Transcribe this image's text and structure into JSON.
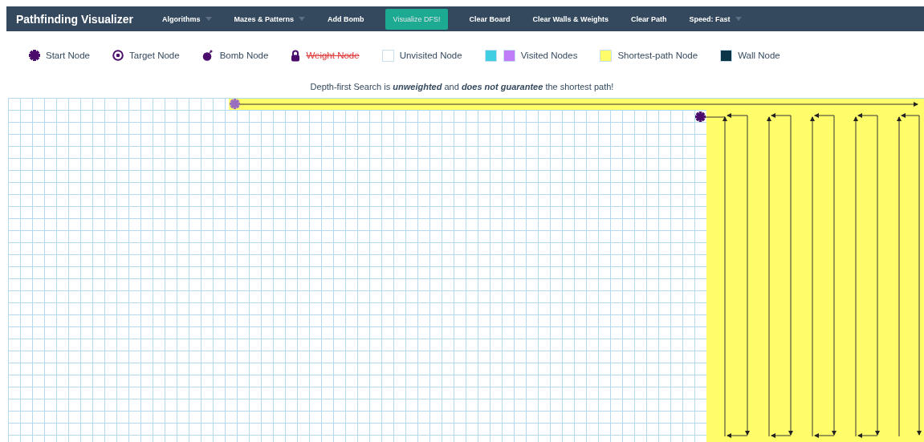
{
  "navbar": {
    "brand": "Pathfinding Visualizer",
    "items": [
      {
        "label": "Algorithms",
        "dropdown": true,
        "highlighted": false
      },
      {
        "label": "Mazes & Patterns",
        "dropdown": true,
        "highlighted": false
      },
      {
        "label": "Add Bomb",
        "dropdown": false,
        "highlighted": false
      },
      {
        "label": "Visualize DFS!",
        "dropdown": false,
        "highlighted": true
      },
      {
        "label": "Clear Board",
        "dropdown": false,
        "highlighted": false
      },
      {
        "label": "Clear Walls & Weights",
        "dropdown": false,
        "highlighted": false
      },
      {
        "label": "Clear Path",
        "dropdown": false,
        "highlighted": false
      },
      {
        "label": "Speed: Fast",
        "dropdown": true,
        "highlighted": false
      }
    ]
  },
  "legend": [
    {
      "kind": "start",
      "label": "Start Node",
      "struck": false
    },
    {
      "kind": "target",
      "label": "Target Node",
      "struck": false
    },
    {
      "kind": "bomb",
      "label": "Bomb Node",
      "struck": false
    },
    {
      "kind": "weight",
      "label": "Weight Node",
      "struck": true
    },
    {
      "kind": "swatch",
      "label": "Unvisited Node",
      "struck": false,
      "swatches": [
        {
          "color": "#ffffff"
        }
      ]
    },
    {
      "kind": "swatch",
      "label": "Visited Nodes",
      "struck": false,
      "swatches": [
        {
          "color": "#40cee3"
        },
        {
          "color": "#c07dfa"
        }
      ]
    },
    {
      "kind": "swatch",
      "label": "Shortest-path Node",
      "struck": false,
      "swatches": [
        {
          "color": "#fffe6a"
        }
      ]
    },
    {
      "kind": "swatch",
      "label": "Wall Node",
      "struck": false,
      "swatches": [
        {
          "color": "#0c3547"
        }
      ]
    }
  ],
  "info": [
    {
      "text": "Depth-first Search is ",
      "emph": false
    },
    {
      "text": "unweighted",
      "emph": true
    },
    {
      "text": " and ",
      "emph": false
    },
    {
      "text": "does not guarantee",
      "emph": true
    },
    {
      "text": " the shortest path!",
      "emph": false
    }
  ]
}
